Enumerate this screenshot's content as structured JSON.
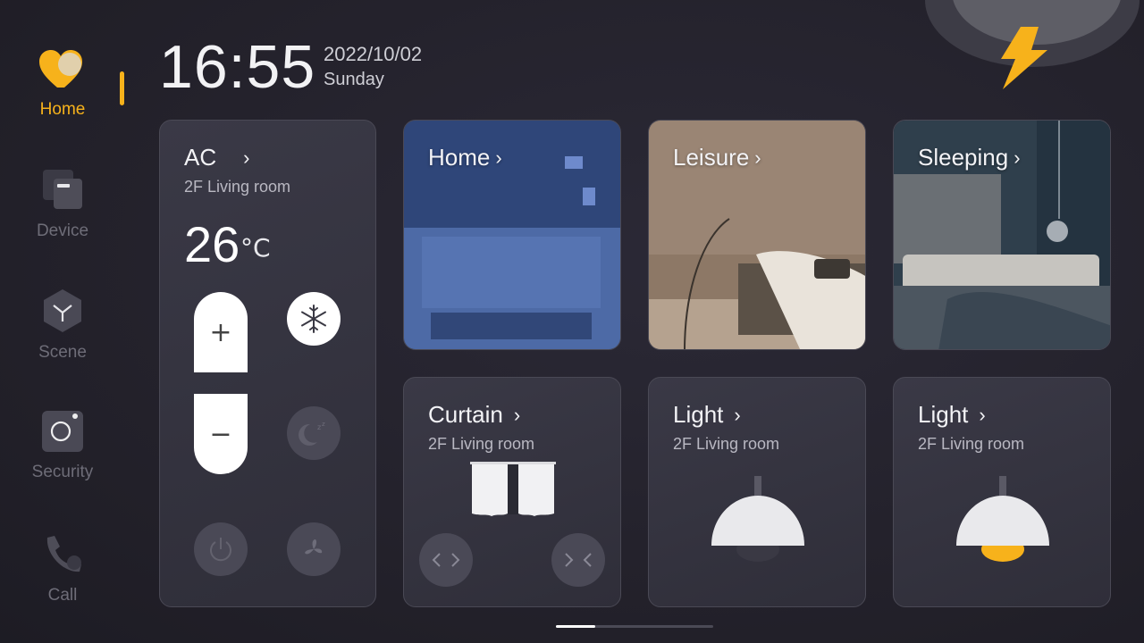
{
  "nav": {
    "items": [
      {
        "label": "Home",
        "icon": "heart-icon",
        "active": true
      },
      {
        "label": "Device",
        "icon": "device-icon",
        "active": false
      },
      {
        "label": "Scene",
        "icon": "scene-hexagon-icon",
        "active": false
      },
      {
        "label": "Security",
        "icon": "camera-icon",
        "active": false
      },
      {
        "label": "Call",
        "icon": "phone-icon",
        "active": false
      }
    ]
  },
  "header": {
    "time": "16:55",
    "date": "2022/10/02",
    "weekday": "Sunday",
    "weather_icon": "thunderstorm-cloud-icon"
  },
  "ac": {
    "title": "AC",
    "room": "2F Living room",
    "temp": "26",
    "unit": "°C",
    "plus_label": "+",
    "minus_label": "−",
    "modes": [
      "snowflake-icon",
      "sleep-moon-icon",
      "power-icon",
      "fan-icon"
    ],
    "active_mode": "snowflake-icon"
  },
  "scenes": [
    {
      "title": "Home"
    },
    {
      "title": "Leisure"
    },
    {
      "title": "Sleeping"
    }
  ],
  "curtain": {
    "title": "Curtain",
    "room": "2F Living room",
    "open_icon": "arrows-open-icon",
    "close_icon": "arrows-close-icon"
  },
  "lights": [
    {
      "title": "Light",
      "room": "2F Living room",
      "on": false
    },
    {
      "title": "Light",
      "room": "2F Living room",
      "on": true
    }
  ],
  "pager": {
    "pages": 4,
    "current": 1
  },
  "colors": {
    "accent": "#f7b21b",
    "background": "#25232f",
    "card": "#34333f"
  }
}
